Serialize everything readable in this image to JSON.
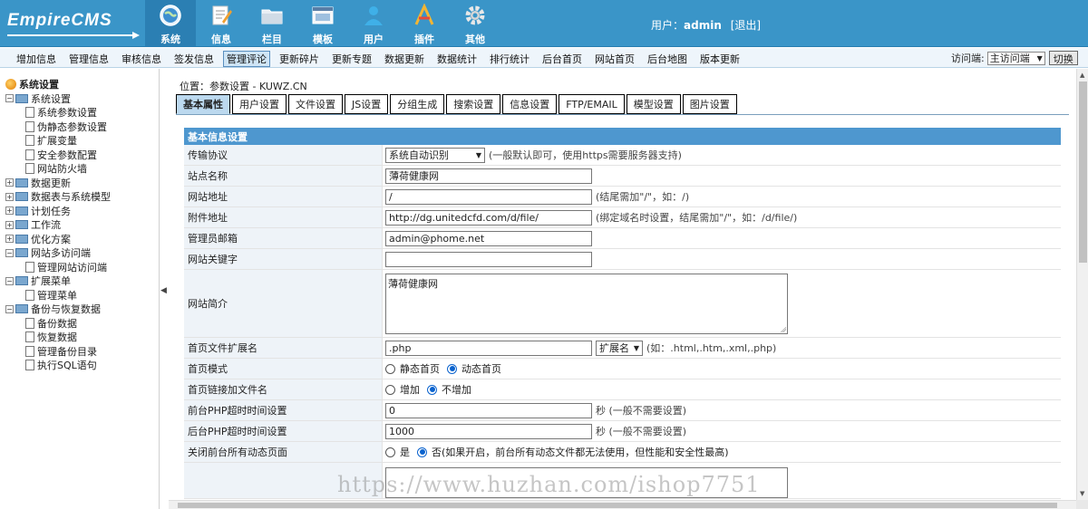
{
  "brand": {
    "logo_text": "EmpireCMS"
  },
  "header": {
    "nav": [
      {
        "label": "系统",
        "icon": "globe-icon"
      },
      {
        "label": "信息",
        "icon": "edit-icon"
      },
      {
        "label": "栏目",
        "icon": "folder-icon"
      },
      {
        "label": "模板",
        "icon": "template-icon"
      },
      {
        "label": "用户",
        "icon": "user-icon"
      },
      {
        "label": "插件",
        "icon": "plugin-icon"
      },
      {
        "label": "其他",
        "icon": "gear-icon"
      }
    ],
    "user_prefix": "用户：",
    "username": "admin",
    "logout": "[退出]"
  },
  "menubar": {
    "items": [
      "增加信息",
      "管理信息",
      "审核信息",
      "签发信息",
      "管理评论",
      "更新碎片",
      "更新专题",
      "数据更新",
      "数据统计",
      "排行统计",
      "后台首页",
      "网站首页",
      "后台地图",
      "版本更新"
    ],
    "visit_label": "访问端:",
    "visit_value": "主访问端",
    "switch_button": "切换"
  },
  "sidebar": {
    "title": "系统设置",
    "tree": [
      {
        "label": "系统设置",
        "type": "folder",
        "expanded": true
      },
      {
        "label": "系统参数设置",
        "type": "doc"
      },
      {
        "label": "伪静态参数设置",
        "type": "doc"
      },
      {
        "label": "扩展变量",
        "type": "doc"
      },
      {
        "label": "安全参数配置",
        "type": "doc"
      },
      {
        "label": "网站防火墙",
        "type": "doc"
      },
      {
        "label": "数据更新",
        "type": "folder",
        "expanded": false
      },
      {
        "label": "数据表与系统模型",
        "type": "folder",
        "expanded": false
      },
      {
        "label": "计划任务",
        "type": "folder",
        "expanded": false
      },
      {
        "label": "工作流",
        "type": "folder",
        "expanded": false
      },
      {
        "label": "优化方案",
        "type": "folder",
        "expanded": false
      },
      {
        "label": "网站多访问端",
        "type": "folder",
        "expanded": true
      },
      {
        "label": "管理网站访问端",
        "type": "doc"
      },
      {
        "label": "扩展菜单",
        "type": "folder",
        "expanded": true
      },
      {
        "label": "管理菜单",
        "type": "doc"
      },
      {
        "label": "备份与恢复数据",
        "type": "folder",
        "expanded": true
      },
      {
        "label": "备份数据",
        "type": "doc"
      },
      {
        "label": "恢复数据",
        "type": "doc"
      },
      {
        "label": "管理备份目录",
        "type": "doc"
      },
      {
        "label": "执行SQL语句",
        "type": "doc"
      }
    ]
  },
  "main": {
    "breadcrumb": "位置：参数设置 - KUWZ.CN",
    "tabs": [
      "基本属性",
      "用户设置",
      "文件设置",
      "JS设置",
      "分组生成",
      "搜索设置",
      "信息设置",
      "FTP/EMAIL",
      "模型设置",
      "图片设置"
    ],
    "section_title": "基本信息设置",
    "fields": {
      "protocol_label": "传输协议",
      "protocol_value": "系统自动识别",
      "protocol_hint": "(一般默认即可，使用https需要服务器支持)",
      "sitename_label": "站点名称",
      "sitename_value": "薄荷健康网",
      "siteurl_label": "网站地址",
      "siteurl_value": "/",
      "siteurl_hint": "(结尾需加\"/\"，如：/)",
      "fileurl_label": "附件地址",
      "fileurl_value": "http://dg.unitedcfd.com/d/file/",
      "fileurl_hint": "(绑定域名时设置，结尾需加\"/\"，如：/d/file/)",
      "email_label": "管理员邮箱",
      "email_value": "admin@phome.net",
      "keywords_label": "网站关键字",
      "keywords_value": "",
      "intro_label": "网站简介",
      "intro_value": "薄荷健康网",
      "ext_label": "首页文件扩展名",
      "ext_value": ".php",
      "ext_select": "扩展名",
      "ext_hint": "(如：.html,.htm,.xml,.php)",
      "mode_label": "首页模式",
      "mode_static": "静态首页",
      "mode_dynamic": "动态首页",
      "link_label": "首页链接加文件名",
      "link_add": "增加",
      "link_noadd": "不增加",
      "front_timeout_label": "前台PHP超时时间设置",
      "front_timeout_value": "0",
      "back_timeout_label": "后台PHP超时时间设置",
      "back_timeout_value": "1000",
      "timeout_hint": "秒 (一般不需要设置)",
      "close_dynamic_label": "关闭前台所有动态页面",
      "close_yes": "是",
      "close_no_hint": "否(如果开启，前台所有动态文件都无法使用，但性能和安全性最高)"
    }
  },
  "watermark": "https://www.huzhan.com/ishop7751"
}
